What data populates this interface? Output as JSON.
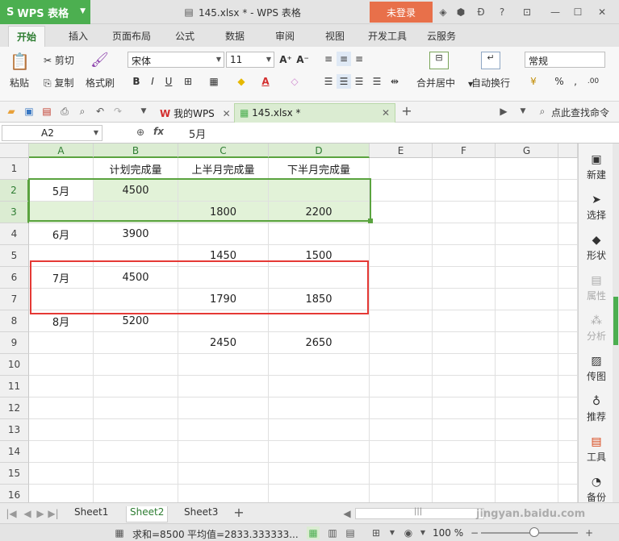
{
  "titlebar": {
    "app_name": "WPS 表格",
    "window_title": "145.xlsx * - WPS 表格",
    "login_label": "未登录"
  },
  "menu_tabs": [
    "开始",
    "插入",
    "页面布局",
    "公式",
    "数据",
    "审阅",
    "视图",
    "开发工具",
    "云服务"
  ],
  "ribbon": {
    "paste": "粘贴",
    "cut": "剪切",
    "copy": "复制",
    "format_painter": "格式刷",
    "font_name": "宋体",
    "font_size": "11",
    "merge_center": "合并居中",
    "wrap_text": "自动换行",
    "number_format": "常规",
    "percent": "%"
  },
  "quickbar": {
    "tab_home": "我的WPS",
    "tab_file": "145.xlsx *",
    "find_command": "点此查找命令"
  },
  "formula": {
    "cell_ref": "A2",
    "fx": "fx",
    "value": "5月"
  },
  "columns": [
    "A",
    "B",
    "C",
    "D",
    "E",
    "F",
    "G"
  ],
  "rows": [
    {
      "n": "1",
      "a": "",
      "b": "计划完成量",
      "c": "上半月完成量",
      "d": "下半月完成量"
    },
    {
      "n": "2",
      "a": "5月",
      "b": "4500",
      "c": "",
      "d": ""
    },
    {
      "n": "3",
      "a": "",
      "b": "",
      "c": "1800",
      "d": "2200"
    },
    {
      "n": "4",
      "a": "6月",
      "b": "3900",
      "c": "",
      "d": ""
    },
    {
      "n": "5",
      "a": "",
      "b": "",
      "c": "1450",
      "d": "1500"
    },
    {
      "n": "6",
      "a": "7月",
      "b": "4500",
      "c": "",
      "d": ""
    },
    {
      "n": "7",
      "a": "",
      "b": "",
      "c": "1790",
      "d": "1850"
    },
    {
      "n": "8",
      "a": "8月",
      "b": "5200",
      "c": "",
      "d": ""
    },
    {
      "n": "9",
      "a": "",
      "b": "",
      "c": "2450",
      "d": "2650"
    },
    {
      "n": "10",
      "a": "",
      "b": "",
      "c": "",
      "d": ""
    },
    {
      "n": "11",
      "a": "",
      "b": "",
      "c": "",
      "d": ""
    },
    {
      "n": "12",
      "a": "",
      "b": "",
      "c": "",
      "d": ""
    },
    {
      "n": "13",
      "a": "",
      "b": "",
      "c": "",
      "d": ""
    },
    {
      "n": "14",
      "a": "",
      "b": "",
      "c": "",
      "d": ""
    },
    {
      "n": "15",
      "a": "",
      "b": "",
      "c": "",
      "d": ""
    },
    {
      "n": "16",
      "a": "",
      "b": "",
      "c": "",
      "d": ""
    }
  ],
  "right_panel": [
    "新建",
    "选择",
    "形状",
    "属性",
    "分析",
    "传图",
    "推荐",
    "工具",
    "备份"
  ],
  "sheets": [
    "Sheet1",
    "Sheet2",
    "Sheet3"
  ],
  "active_sheet": "Sheet2",
  "status": {
    "sum": "求和=8500",
    "average": "平均值=2833.333333...",
    "zoom": "100 %"
  },
  "watermark": "jingyan.baidu.com",
  "colors": {
    "accent": "#4caf50",
    "selection": "#5aa33f",
    "highlight_box": "#e53935",
    "login": "#e8704a"
  }
}
